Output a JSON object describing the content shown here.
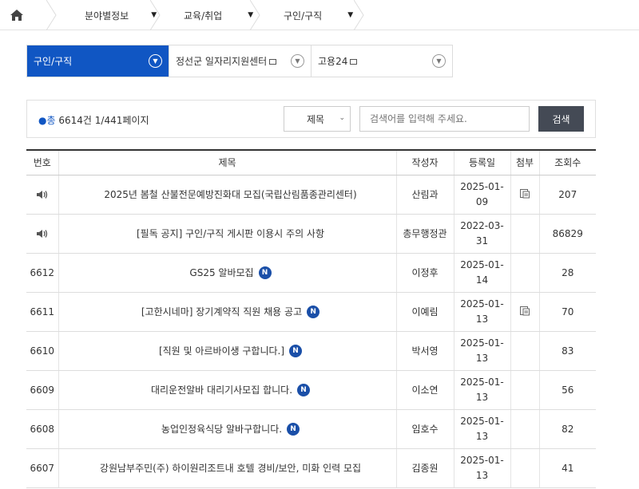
{
  "breadcrumb": {
    "home_icon": "home-icon",
    "items": [
      {
        "label": "분야별정보"
      },
      {
        "label": "교육/취업"
      },
      {
        "label": "구인/구직"
      }
    ]
  },
  "tabs": [
    {
      "label": "구인/구직",
      "active": true
    },
    {
      "label": "정선군 일자리지원센터",
      "active": false,
      "external": true
    },
    {
      "label": "고용24",
      "active": false,
      "external": true
    }
  ],
  "search": {
    "total_prefix": "총",
    "total_count": "6614건",
    "page_info": "1/441페이지",
    "field_selected": "제목",
    "keyword_placeholder": "검색어를 입력해 주세요.",
    "button_label": "검색"
  },
  "table": {
    "headers": [
      "번호",
      "제목",
      "작성자",
      "등록일",
      "첨부",
      "조회수"
    ],
    "rows": [
      {
        "no": "",
        "notice": true,
        "title": "2025년 봄철 산불전문예방진화대 모집(국립산림품종관리센터)",
        "new": false,
        "author": "산림과",
        "date": "2025-01-09",
        "date_l1": "2025-01-",
        "date_l2": "09",
        "attach": true,
        "views": "207"
      },
      {
        "no": "",
        "notice": true,
        "title": "[필독 공지] 구인/구직 게시판 이용시 주의 사항",
        "new": false,
        "author": "총무행정관",
        "date": "2022-03-31",
        "date_l1": "2022-03-",
        "date_l2": "31",
        "attach": false,
        "views": "86829"
      },
      {
        "no": "6612",
        "notice": false,
        "title": "GS25 알바모집",
        "new": true,
        "author": "이정후",
        "date": "2025-01-14",
        "date_l1": "2025-01-",
        "date_l2": "14",
        "attach": false,
        "views": "28"
      },
      {
        "no": "6611",
        "notice": false,
        "title": "[고한시네마] 장기계약직 직원 채용 공고",
        "new": true,
        "author": "이예림",
        "date": "2025-01-13",
        "date_l1": "2025-01-",
        "date_l2": "13",
        "attach": true,
        "views": "70"
      },
      {
        "no": "6610",
        "notice": false,
        "title": "[직원 및 아르바이생 구합니다.]",
        "new": true,
        "author": "박서영",
        "date": "2025-01-13",
        "date_l1": "2025-01-",
        "date_l2": "13",
        "attach": false,
        "views": "83"
      },
      {
        "no": "6609",
        "notice": false,
        "title": "대리운전알바 대리기사모집 합니다.",
        "new": true,
        "author": "이소연",
        "date": "2025-01-13",
        "date_l1": "2025-01-",
        "date_l2": "13",
        "attach": false,
        "views": "56"
      },
      {
        "no": "6608",
        "notice": false,
        "title": "농업인정육식당 알바구합니다.",
        "new": true,
        "author": "임호수",
        "date": "2025-01-13",
        "date_l1": "2025-01-",
        "date_l2": "13",
        "attach": false,
        "views": "82"
      },
      {
        "no": "6607",
        "notice": false,
        "title": "강원남부주민(주) 하이원리조트내 호텔 경비/보안, 미화 인력 모집",
        "new": false,
        "author": "김종원",
        "date": "2025-01-13",
        "date_l1": "2025-01-",
        "date_l2": "13",
        "attach": false,
        "views": "41"
      }
    ]
  },
  "new_badge": "N",
  "colors": {
    "accent": "#1056c3",
    "badge": "#1a4fa8",
    "button": "#444a55"
  }
}
